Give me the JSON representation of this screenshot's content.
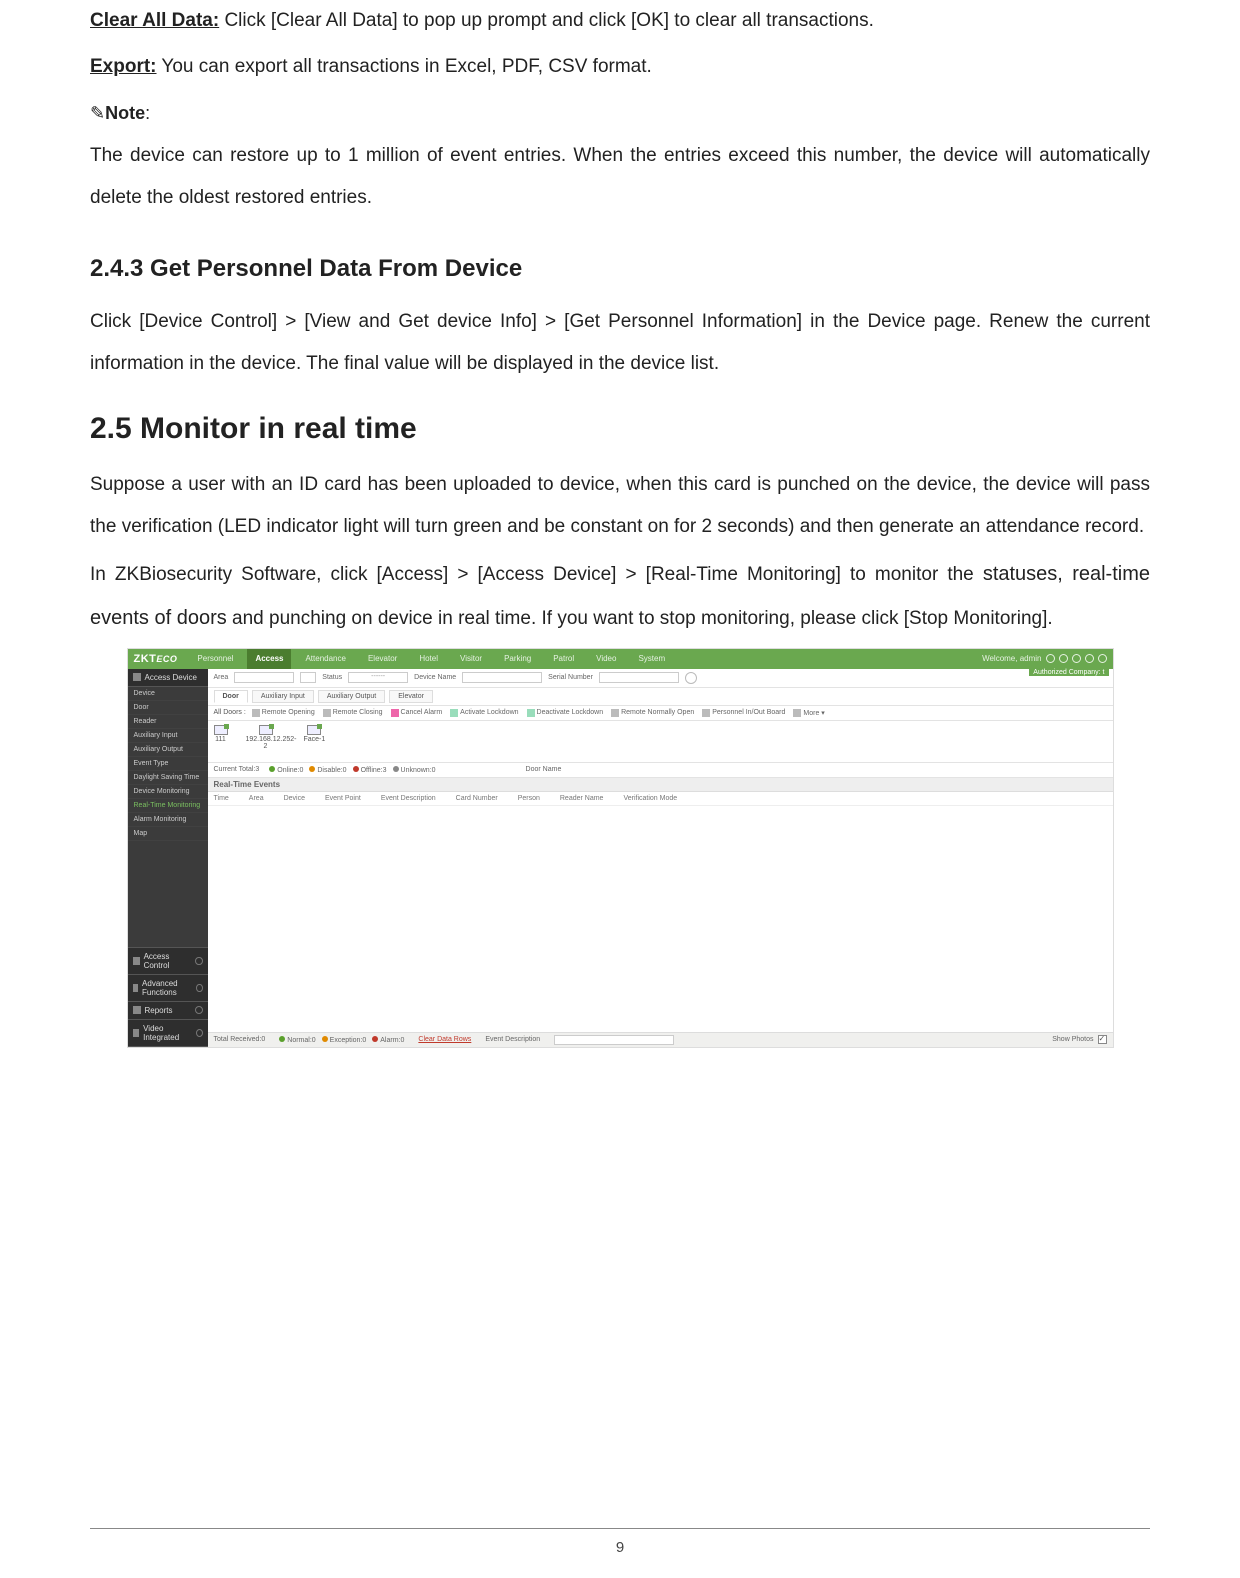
{
  "text": {
    "clearAllLabel": "Clear All Data:",
    "clearAllBody": " Click [Clear All Data] to pop up prompt and click [OK] to clear all transactions.",
    "exportLabel": "Export:",
    "exportBody": " You can export all transactions in Excel, PDF, CSV format.",
    "noteIcon": "✎",
    "noteLabel": "Note",
    "noteColon": ":",
    "noteBody": "The device can restore up to 1 million of event entries. When the entries exceed this number, the device will automatically delete the oldest restored entries.",
    "h243": "2.4.3 Get Personnel Data From Device",
    "body243": "Click [Device Control] > [View and Get device Info] > [Get Personnel Information] in the Device page. Renew the current information in the device. The final value will be displayed in the device list.",
    "h25": "2.5 Monitor in real time",
    "body25a": "Suppose a user with an ID card has been uploaded to device, when this card is punched on the device, the device will pass the verification (LED indicator light will turn green and be constant on for 2 seconds) and then generate an attendance record.",
    "body25b_1": "In ZKBiosecurity Software, click [Access] > [Access Device] > [Real-Time Monitoring] to monitor the ",
    "body25b_2": "statuses, real-time events of doors",
    "body25b_3": " and punching on device in real time. If you want to stop monitoring, please click [Stop Monitoring].",
    "pageNumber": "9"
  },
  "screenshot": {
    "brand": "ZKT",
    "brandSuffix": "ECO",
    "topTabs": [
      "Personnel",
      "Access",
      "Attendance",
      "Elevator",
      "Hotel",
      "Visitor",
      "Parking",
      "Patrol",
      "Video",
      "System"
    ],
    "activeTopTab": "Access",
    "welcome": "Welcome, admin",
    "authorized": "Authorized Company: t",
    "sidebar": {
      "section": "Access Device",
      "items": [
        "Device",
        "Door",
        "Reader",
        "Auxiliary Input",
        "Auxiliary Output",
        "Event Type",
        "Daylight Saving Time",
        "Device Monitoring",
        "Real-Time Monitoring",
        "Alarm Monitoring",
        "Map"
      ],
      "activeItem": "Real-Time Monitoring",
      "bottom": [
        "Access Control",
        "Advanced Functions",
        "Reports",
        "Video Integrated"
      ]
    },
    "filter": {
      "areaLabel": "Area",
      "statusLabel": "Status",
      "statusValue": "------",
      "deviceNameLabel": "Device Name",
      "serialLabel": "Serial Number"
    },
    "subtabs": [
      "Door",
      "Auxiliary Input",
      "Auxiliary Output",
      "Elevator"
    ],
    "activeSubtab": "Door",
    "toolbar": {
      "allDoors": "All Doors :",
      "buttons": [
        {
          "label": "Remote Opening",
          "icon": "gray"
        },
        {
          "label": "Remote Closing",
          "icon": "gray"
        },
        {
          "label": "Cancel Alarm",
          "icon": "org"
        },
        {
          "label": "Activate Lockdown",
          "icon": "green"
        },
        {
          "label": "Deactivate Lockdown",
          "icon": "green"
        },
        {
          "label": "Remote Normally Open",
          "icon": "gray"
        },
        {
          "label": "Personnel In/Out Board",
          "icon": "gray"
        },
        {
          "label": "More ▾",
          "icon": "gray"
        }
      ]
    },
    "devices": [
      {
        "name": "111"
      },
      {
        "name": "192.168.12.252-2"
      },
      {
        "name": "Face-1"
      }
    ],
    "status": {
      "currentTotal": "Current Total:3",
      "legend": [
        {
          "color": "g",
          "label": "Online:0"
        },
        {
          "color": "b",
          "label": "Disable:0"
        },
        {
          "color": "r",
          "label": "Offline:3"
        },
        {
          "color": "o",
          "label": "Unknown:0"
        }
      ],
      "doorNameLabel": "Door Name"
    },
    "realtime": {
      "header": "Real-Time Events",
      "columns": [
        "Time",
        "Area",
        "Device",
        "Event Point",
        "Event Description",
        "Card Number",
        "Person",
        "Reader Name",
        "Verification Mode"
      ]
    },
    "footer": {
      "totalReceived": "Total Received:0",
      "legend": [
        {
          "color": "g",
          "label": "Normal:0"
        },
        {
          "color": "b",
          "label": "Exception:0"
        },
        {
          "color": "r",
          "label": "Alarm:0"
        }
      ],
      "clearRows": "Clear Data Rows",
      "eventDescLabel": "Event Description",
      "showPhoto": "Show Photos"
    }
  }
}
